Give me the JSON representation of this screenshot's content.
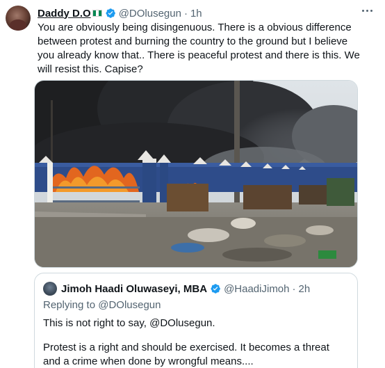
{
  "tweet": {
    "display_name": "Daddy D.O",
    "handle": "@DOlusegun",
    "separator": "·",
    "time": "1h",
    "text": "You are obviously being disingenuous. There is a obvious difference between protest and burning the country to the ground but I believe you already know that.. There is peaceful protest and there is this. We will resist this. Capise?",
    "icons": {
      "verified": "verified-badge-icon",
      "flag": "nigeria-flag-icon",
      "more": "more-options-icon"
    },
    "colors": {
      "verified": "#1d9bf0",
      "text_secondary": "#536471",
      "text_primary": "#0f1419",
      "border": "#cfd9de"
    }
  },
  "quote": {
    "display_name": "Jimoh Haadi Oluwaseyi, MBA",
    "handle": "@HaadiJimoh",
    "separator": "·",
    "time": "2h",
    "replying_prefix": "Replying to",
    "replying_to": "@DOlusegun",
    "text_line1": "This is not right to say, @DOlusegun.",
    "text_line2": "Protest is a right and should be exercised. It becomes a threat and a crime when done by wrongful means...."
  }
}
